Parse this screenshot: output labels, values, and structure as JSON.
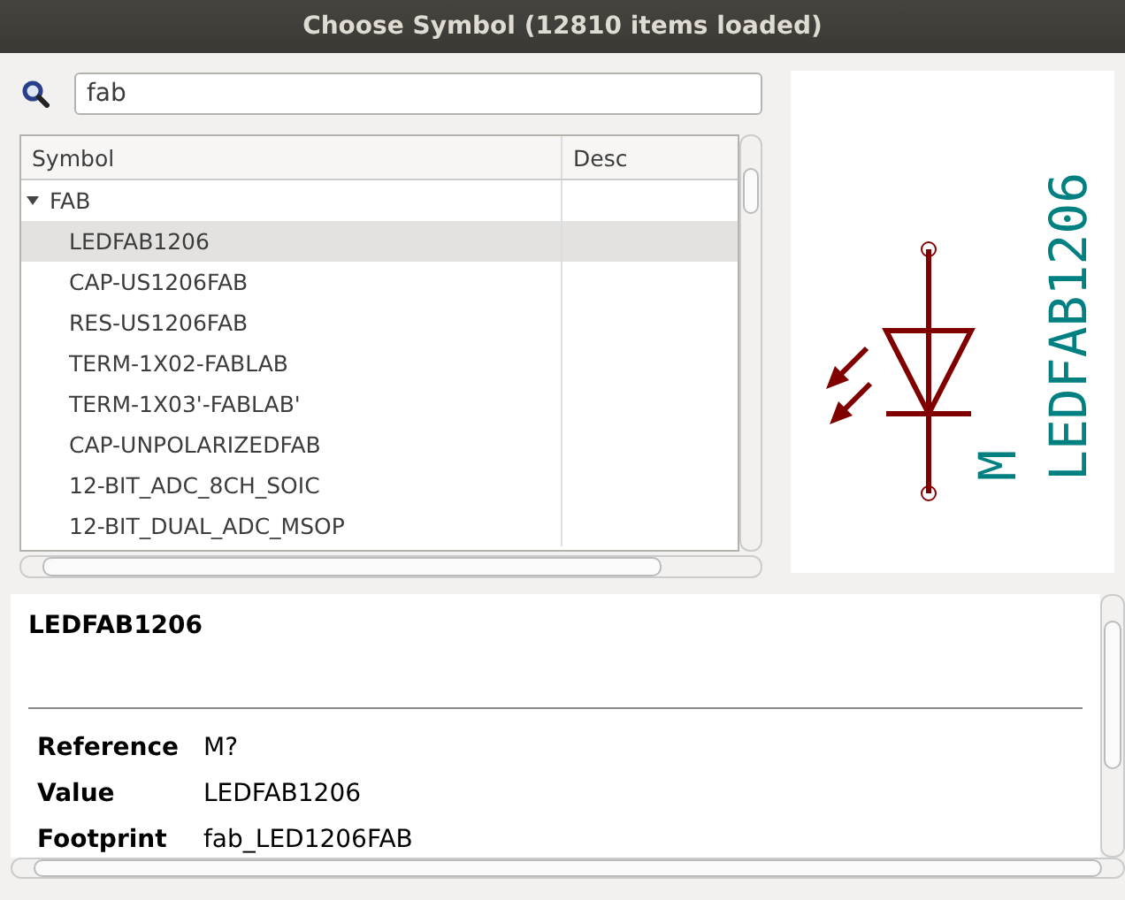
{
  "window": {
    "title": "Choose Symbol (12810 items loaded)"
  },
  "search": {
    "value": "fab"
  },
  "table": {
    "columns": [
      "Symbol",
      "Desc"
    ],
    "groups": [
      {
        "name": "FAB",
        "expanded": true,
        "children": [
          {
            "name": "LEDFAB1206",
            "selected": true
          },
          {
            "name": "CAP-US1206FAB",
            "selected": false
          },
          {
            "name": "RES-US1206FAB",
            "selected": false
          },
          {
            "name": "TERM-1X02-FABLAB",
            "selected": false
          },
          {
            "name": "TERM-1X03'-FABLAB'",
            "selected": false
          },
          {
            "name": "CAP-UNPOLARIZEDFAB",
            "selected": false
          },
          {
            "name": "12-BIT_ADC_8CH_SOIC",
            "selected": false
          },
          {
            "name": "12-BIT_DUAL_ADC_MSOP",
            "selected": false
          }
        ]
      }
    ]
  },
  "preview": {
    "value": "LEDFAB1206",
    "reference": "M"
  },
  "details": {
    "title": "LEDFAB1206",
    "fields": [
      {
        "label": "Reference",
        "value": "M?"
      },
      {
        "label": "Value",
        "value": "LEDFAB1206"
      },
      {
        "label": "Footprint",
        "value": "fab_LED1206FAB"
      }
    ]
  }
}
